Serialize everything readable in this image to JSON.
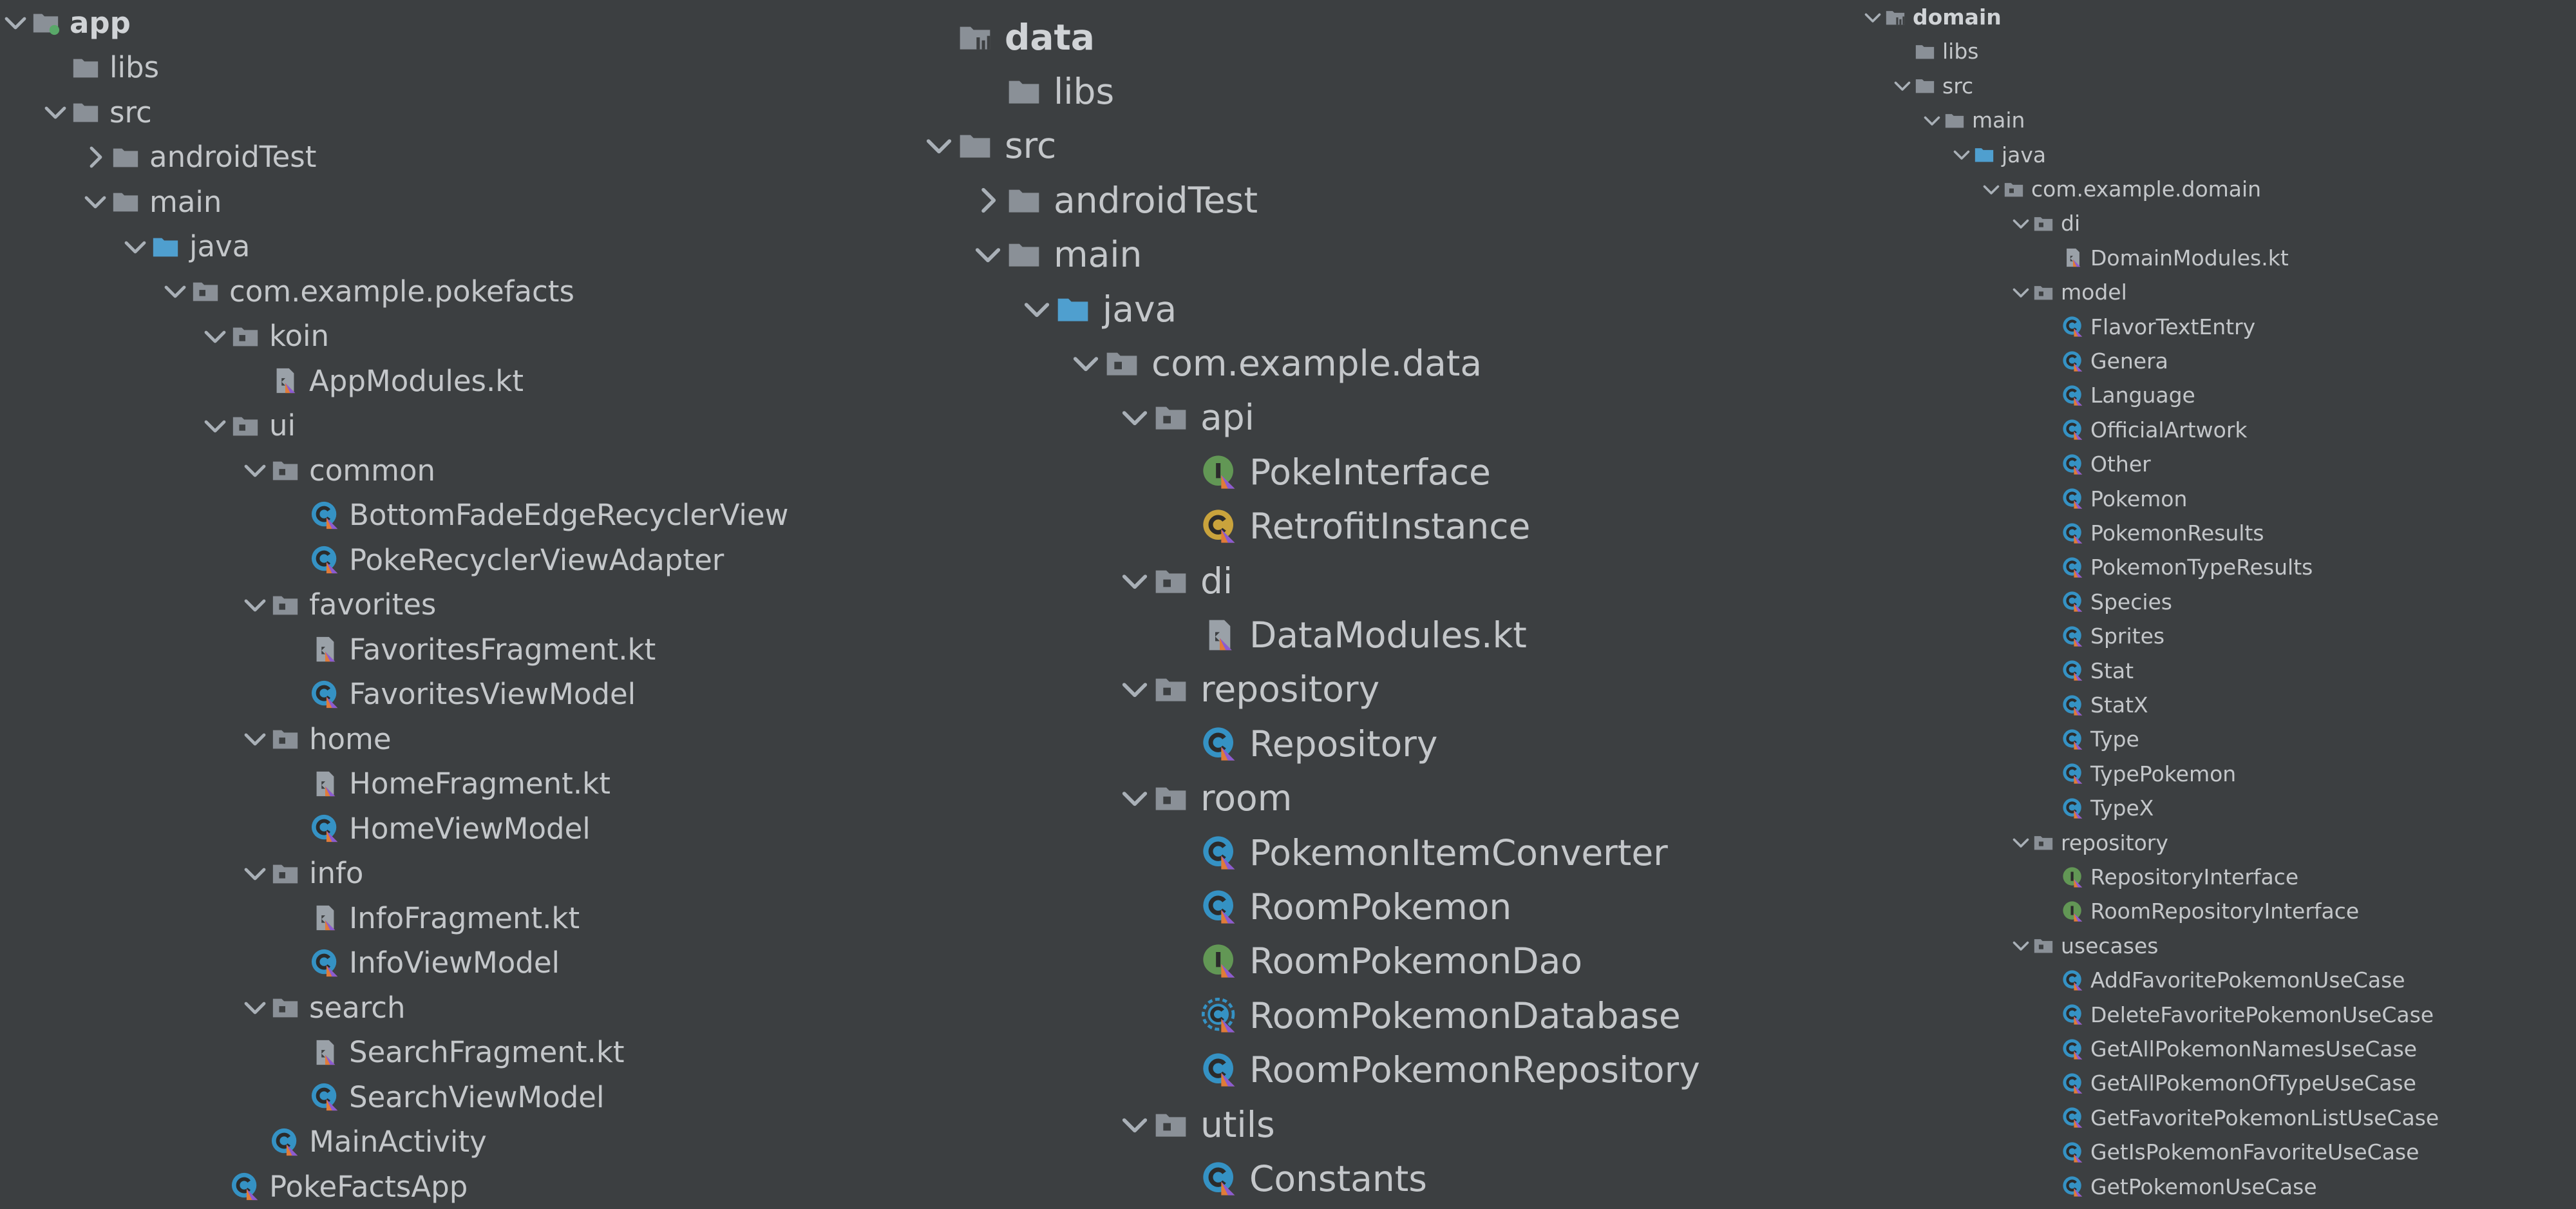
{
  "colors": {
    "background": "#3c3f41",
    "text": "#c4c7ca",
    "folder": "#8a9097",
    "source_folder": "#4f9fcf",
    "class_icon": "#3592c4",
    "interface_icon": "#629755",
    "object_icon": "#c9a33c",
    "kotlin_badge": "#e07b39"
  },
  "trees": [
    {
      "id": "app",
      "rows": [
        {
          "indent": 0,
          "chevron": "down",
          "icon": "module-folder-icon",
          "label": "app",
          "bold": true
        },
        {
          "indent": 1,
          "chevron": "",
          "icon": "folder-icon",
          "label": "libs"
        },
        {
          "indent": 1,
          "chevron": "down",
          "icon": "folder-icon",
          "label": "src"
        },
        {
          "indent": 2,
          "chevron": "right",
          "icon": "folder-icon",
          "label": "androidTest"
        },
        {
          "indent": 2,
          "chevron": "down",
          "icon": "folder-icon",
          "label": "main"
        },
        {
          "indent": 3,
          "chevron": "down",
          "icon": "source-folder-icon",
          "label": "java"
        },
        {
          "indent": 4,
          "chevron": "down",
          "icon": "package-icon",
          "label": "com.example.pokefacts"
        },
        {
          "indent": 5,
          "chevron": "down",
          "icon": "package-icon",
          "label": "koin"
        },
        {
          "indent": 6,
          "chevron": "",
          "icon": "kotlin-file-icon",
          "label": "AppModules.kt"
        },
        {
          "indent": 5,
          "chevron": "down",
          "icon": "package-icon",
          "label": "ui"
        },
        {
          "indent": 6,
          "chevron": "down",
          "icon": "package-icon",
          "label": "common"
        },
        {
          "indent": 7,
          "chevron": "",
          "icon": "kotlin-class-icon",
          "label": "BottomFadeEdgeRecyclerView"
        },
        {
          "indent": 7,
          "chevron": "",
          "icon": "kotlin-class-icon",
          "label": "PokeRecyclerViewAdapter"
        },
        {
          "indent": 6,
          "chevron": "down",
          "icon": "package-icon",
          "label": "favorites"
        },
        {
          "indent": 7,
          "chevron": "",
          "icon": "kotlin-file-icon",
          "label": "FavoritesFragment.kt"
        },
        {
          "indent": 7,
          "chevron": "",
          "icon": "kotlin-class-icon",
          "label": "FavoritesViewModel"
        },
        {
          "indent": 6,
          "chevron": "down",
          "icon": "package-icon",
          "label": "home"
        },
        {
          "indent": 7,
          "chevron": "",
          "icon": "kotlin-file-icon",
          "label": "HomeFragment.kt"
        },
        {
          "indent": 7,
          "chevron": "",
          "icon": "kotlin-class-icon",
          "label": "HomeViewModel"
        },
        {
          "indent": 6,
          "chevron": "down",
          "icon": "package-icon",
          "label": "info"
        },
        {
          "indent": 7,
          "chevron": "",
          "icon": "kotlin-file-icon",
          "label": "InfoFragment.kt"
        },
        {
          "indent": 7,
          "chevron": "",
          "icon": "kotlin-class-icon",
          "label": "InfoViewModel"
        },
        {
          "indent": 6,
          "chevron": "down",
          "icon": "package-icon",
          "label": "search"
        },
        {
          "indent": 7,
          "chevron": "",
          "icon": "kotlin-file-icon",
          "label": "SearchFragment.kt"
        },
        {
          "indent": 7,
          "chevron": "",
          "icon": "kotlin-class-icon",
          "label": "SearchViewModel"
        },
        {
          "indent": 6,
          "chevron": "",
          "icon": "kotlin-class-icon",
          "label": "MainActivity"
        },
        {
          "indent": 5,
          "chevron": "",
          "icon": "kotlin-class-icon",
          "label": "PokeFactsApp"
        }
      ]
    },
    {
      "id": "data",
      "rows": [
        {
          "indent": 0,
          "chevron": "",
          "icon": "library-module-icon",
          "label": "data",
          "bold": true
        },
        {
          "indent": 1,
          "chevron": "",
          "icon": "folder-icon",
          "label": "libs"
        },
        {
          "indent": 0,
          "chevron": "down",
          "icon": "folder-icon",
          "label": "src"
        },
        {
          "indent": 1,
          "chevron": "right",
          "icon": "folder-icon",
          "label": "androidTest"
        },
        {
          "indent": 1,
          "chevron": "down",
          "icon": "folder-icon",
          "label": "main"
        },
        {
          "indent": 2,
          "chevron": "down",
          "icon": "source-folder-icon",
          "label": "java"
        },
        {
          "indent": 3,
          "chevron": "down",
          "icon": "package-icon",
          "label": "com.example.data"
        },
        {
          "indent": 4,
          "chevron": "down",
          "icon": "package-icon",
          "label": "api"
        },
        {
          "indent": 5,
          "chevron": "",
          "icon": "kotlin-interface-icon",
          "label": "PokeInterface"
        },
        {
          "indent": 5,
          "chevron": "",
          "icon": "kotlin-object-icon",
          "label": "RetrofitInstance"
        },
        {
          "indent": 4,
          "chevron": "down",
          "icon": "package-icon",
          "label": "di"
        },
        {
          "indent": 5,
          "chevron": "",
          "icon": "kotlin-file-icon",
          "label": "DataModules.kt"
        },
        {
          "indent": 4,
          "chevron": "down",
          "icon": "package-icon",
          "label": "repository"
        },
        {
          "indent": 5,
          "chevron": "",
          "icon": "kotlin-class-icon",
          "label": "Repository"
        },
        {
          "indent": 4,
          "chevron": "down",
          "icon": "package-icon",
          "label": "room"
        },
        {
          "indent": 5,
          "chevron": "",
          "icon": "kotlin-class-icon",
          "label": "PokemonItemConverter"
        },
        {
          "indent": 5,
          "chevron": "",
          "icon": "kotlin-class-icon",
          "label": "RoomPokemon"
        },
        {
          "indent": 5,
          "chevron": "",
          "icon": "kotlin-interface-icon",
          "label": "RoomPokemonDao"
        },
        {
          "indent": 5,
          "chevron": "",
          "icon": "kotlin-abstract-class-icon",
          "label": "RoomPokemonDatabase"
        },
        {
          "indent": 5,
          "chevron": "",
          "icon": "kotlin-class-icon",
          "label": "RoomPokemonRepository"
        },
        {
          "indent": 4,
          "chevron": "down",
          "icon": "package-icon",
          "label": "utils"
        },
        {
          "indent": 5,
          "chevron": "",
          "icon": "kotlin-class-icon",
          "label": "Constants"
        }
      ]
    },
    {
      "id": "domain",
      "rows": [
        {
          "indent": 0,
          "chevron": "down",
          "icon": "library-module-icon",
          "label": "domain",
          "bold": true
        },
        {
          "indent": 1,
          "chevron": "",
          "icon": "folder-icon",
          "label": "libs"
        },
        {
          "indent": 1,
          "chevron": "down",
          "icon": "folder-icon",
          "label": "src"
        },
        {
          "indent": 2,
          "chevron": "down",
          "icon": "folder-icon",
          "label": "main"
        },
        {
          "indent": 3,
          "chevron": "down",
          "icon": "source-folder-icon",
          "label": "java"
        },
        {
          "indent": 4,
          "chevron": "down",
          "icon": "package-icon",
          "label": "com.example.domain"
        },
        {
          "indent": 5,
          "chevron": "down",
          "icon": "package-icon",
          "label": "di"
        },
        {
          "indent": 6,
          "chevron": "",
          "icon": "kotlin-file-icon",
          "label": "DomainModules.kt"
        },
        {
          "indent": 5,
          "chevron": "down",
          "icon": "package-icon",
          "label": "model"
        },
        {
          "indent": 6,
          "chevron": "",
          "icon": "kotlin-class-icon",
          "label": "FlavorTextEntry"
        },
        {
          "indent": 6,
          "chevron": "",
          "icon": "kotlin-class-icon",
          "label": "Genera"
        },
        {
          "indent": 6,
          "chevron": "",
          "icon": "kotlin-class-icon",
          "label": "Language"
        },
        {
          "indent": 6,
          "chevron": "",
          "icon": "kotlin-class-icon",
          "label": "OfficialArtwork"
        },
        {
          "indent": 6,
          "chevron": "",
          "icon": "kotlin-class-icon",
          "label": "Other"
        },
        {
          "indent": 6,
          "chevron": "",
          "icon": "kotlin-class-icon",
          "label": "Pokemon"
        },
        {
          "indent": 6,
          "chevron": "",
          "icon": "kotlin-class-icon",
          "label": "PokemonResults"
        },
        {
          "indent": 6,
          "chevron": "",
          "icon": "kotlin-class-icon",
          "label": "PokemonTypeResults"
        },
        {
          "indent": 6,
          "chevron": "",
          "icon": "kotlin-class-icon",
          "label": "Species"
        },
        {
          "indent": 6,
          "chevron": "",
          "icon": "kotlin-class-icon",
          "label": "Sprites"
        },
        {
          "indent": 6,
          "chevron": "",
          "icon": "kotlin-class-icon",
          "label": "Stat"
        },
        {
          "indent": 6,
          "chevron": "",
          "icon": "kotlin-class-icon",
          "label": "StatX"
        },
        {
          "indent": 6,
          "chevron": "",
          "icon": "kotlin-class-icon",
          "label": "Type"
        },
        {
          "indent": 6,
          "chevron": "",
          "icon": "kotlin-class-icon",
          "label": "TypePokemon"
        },
        {
          "indent": 6,
          "chevron": "",
          "icon": "kotlin-class-icon",
          "label": "TypeX"
        },
        {
          "indent": 5,
          "chevron": "down",
          "icon": "package-icon",
          "label": "repository"
        },
        {
          "indent": 6,
          "chevron": "",
          "icon": "kotlin-interface-icon",
          "label": "RepositoryInterface"
        },
        {
          "indent": 6,
          "chevron": "",
          "icon": "kotlin-interface-icon",
          "label": "RoomRepositoryInterface"
        },
        {
          "indent": 5,
          "chevron": "down",
          "icon": "package-icon",
          "label": "usecases"
        },
        {
          "indent": 6,
          "chevron": "",
          "icon": "kotlin-class-icon",
          "label": "AddFavoritePokemonUseCase"
        },
        {
          "indent": 6,
          "chevron": "",
          "icon": "kotlin-class-icon",
          "label": "DeleteFavoritePokemonUseCase"
        },
        {
          "indent": 6,
          "chevron": "",
          "icon": "kotlin-class-icon",
          "label": "GetAllPokemonNamesUseCase"
        },
        {
          "indent": 6,
          "chevron": "",
          "icon": "kotlin-class-icon",
          "label": "GetAllPokemonOfTypeUseCase"
        },
        {
          "indent": 6,
          "chevron": "",
          "icon": "kotlin-class-icon",
          "label": "GetFavoritePokemonListUseCase"
        },
        {
          "indent": 6,
          "chevron": "",
          "icon": "kotlin-class-icon",
          "label": "GetIsPokemonFavoriteUseCase"
        },
        {
          "indent": 6,
          "chevron": "",
          "icon": "kotlin-class-icon",
          "label": "GetPokemonUseCase"
        }
      ]
    }
  ]
}
